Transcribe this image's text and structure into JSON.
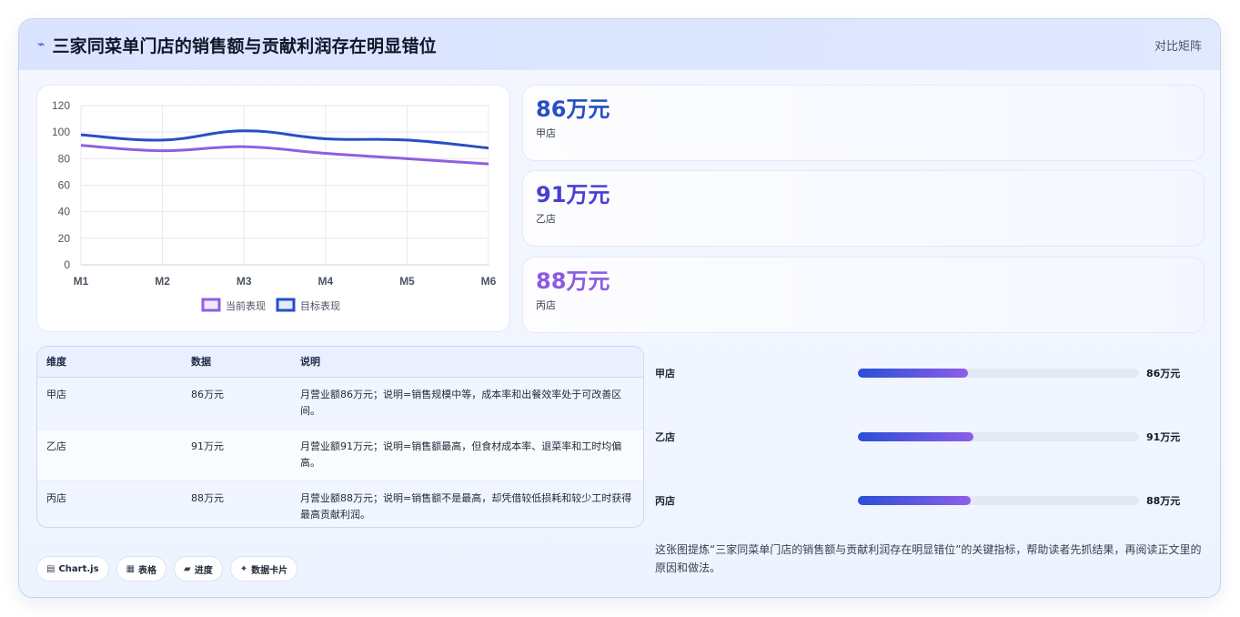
{
  "header": {
    "icon": "trend-line-icon",
    "title": "三家同菜单门店的销售额与贡献利润存在明显错位",
    "right_label": "对比矩阵"
  },
  "chart_data": {
    "type": "line",
    "x": [
      "M1",
      "M2",
      "M3",
      "M4",
      "M5",
      "M6"
    ],
    "ylim": [
      0,
      120
    ],
    "yticks": [
      "0",
      "20",
      "40",
      "60",
      "80",
      "100",
      "120"
    ],
    "grid": true,
    "legend_position": "bottom",
    "series": [
      {
        "name": "当前表现",
        "color": "#8f5fe0",
        "values": [
          90,
          86,
          89,
          84,
          80,
          76
        ]
      },
      {
        "name": "目标表现",
        "color": "#274fc4",
        "values": [
          98,
          94,
          101,
          95,
          94,
          88
        ]
      }
    ]
  },
  "stats": [
    {
      "value": "86万元",
      "label": "甲店",
      "color": "#274fc4"
    },
    {
      "value": "91万元",
      "label": "乙店",
      "color": "#4a3fd0"
    },
    {
      "value": "88万元",
      "label": "丙店",
      "color": "#8a5be0"
    }
  ],
  "table": {
    "headers": [
      "维度",
      "数据",
      "说明"
    ],
    "rows": [
      [
        "甲店",
        "86万元",
        "月营业额86万元；说明=销售规模中等，成本率和出餐效率处于可改善区间。"
      ],
      [
        "乙店",
        "91万元",
        "月营业额91万元；说明=销售额最高，但食材成本率、退菜率和工时均偏高。"
      ],
      [
        "丙店",
        "88万元",
        "月营业额88万元；说明=销售额不是最高，却凭借较低损耗和较少工时获得最高贡献利润。"
      ]
    ]
  },
  "progress": [
    {
      "label": "甲店",
      "value": "86万元",
      "fraction": 0.39
    },
    {
      "label": "乙店",
      "value": "91万元",
      "fraction": 0.41
    },
    {
      "label": "丙店",
      "value": "88万元",
      "fraction": 0.4
    }
  ],
  "chips": [
    {
      "icon": "chart-icon",
      "glyph": "▤",
      "label": "Chart.js"
    },
    {
      "icon": "table-icon",
      "glyph": "▦",
      "label": "表格"
    },
    {
      "icon": "progress-icon",
      "glyph": "▰",
      "label": "进度"
    },
    {
      "icon": "sparkle-icon",
      "glyph": "✦",
      "label": "数据卡片"
    }
  ],
  "caption": "这张图提炼“三家同菜单门店的销售额与贡献利润存在明显错位”的关键指标，帮助读者先抓结果，再阅读正文里的原因和做法。"
}
